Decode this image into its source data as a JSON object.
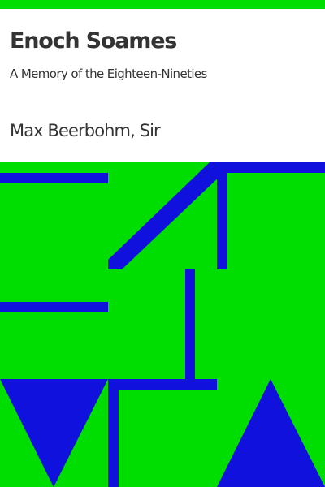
{
  "book": {
    "title": "Enoch Soames",
    "subtitle": "A Memory of the Eighteen-Nineties",
    "author": "Max Beerbohm, Sir"
  },
  "colors": {
    "band": "#00dd00",
    "background": "#00dd00",
    "shape": "#1111dd",
    "text": "#333333"
  }
}
